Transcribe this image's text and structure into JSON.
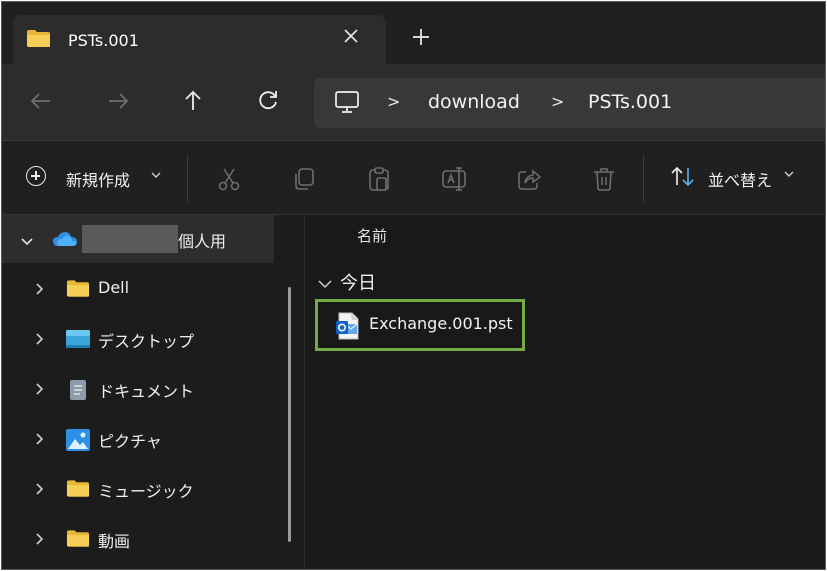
{
  "window": {
    "tab": {
      "title": "PSTs.001",
      "folder_icon": "folder-icon",
      "close_icon": "close-icon"
    },
    "new_tab_icon": "plus-icon"
  },
  "navigation": {
    "back_icon": "arrow-left-icon",
    "forward_icon": "arrow-right-icon",
    "up_icon": "arrow-up-icon",
    "refresh_icon": "refresh-icon",
    "address": {
      "root_icon": "computer-icon",
      "separator": ">",
      "crumbs": [
        "download",
        "PSTs.001"
      ]
    }
  },
  "toolbar": {
    "new_label": "新規作成",
    "new_icon": "plus-circle-icon",
    "buttons": [
      "cut-icon",
      "copy-icon",
      "paste-icon",
      "rename-icon",
      "share-icon",
      "delete-icon"
    ],
    "sort_label": "並べ替え",
    "sort_icon": "sort-icon",
    "dropdown_glyph": "⌄"
  },
  "sidebar": {
    "items": [
      {
        "label": "個人用",
        "icon": "onedrive-icon",
        "expanded": true,
        "selected": true
      },
      {
        "label": "Dell",
        "icon": "folder-icon"
      },
      {
        "label": "デスクトップ",
        "icon": "desktop-icon"
      },
      {
        "label": "ドキュメント",
        "icon": "document-icon"
      },
      {
        "label": "ピクチャ",
        "icon": "pictures-icon"
      },
      {
        "label": "ミュージック",
        "icon": "folder-icon"
      },
      {
        "label": "動画",
        "icon": "folder-icon"
      }
    ]
  },
  "content": {
    "column_header": "名前",
    "group": {
      "label": "今日"
    },
    "files": [
      {
        "name": "Exchange.001.pst",
        "icon": "outlook-pst-icon",
        "highlighted": true
      }
    ]
  },
  "colors": {
    "background": "#191919",
    "highlight_border": "#74ab42",
    "folder_yellow": "#f3c64b",
    "onedrive_blue": "#2f8fe0"
  }
}
